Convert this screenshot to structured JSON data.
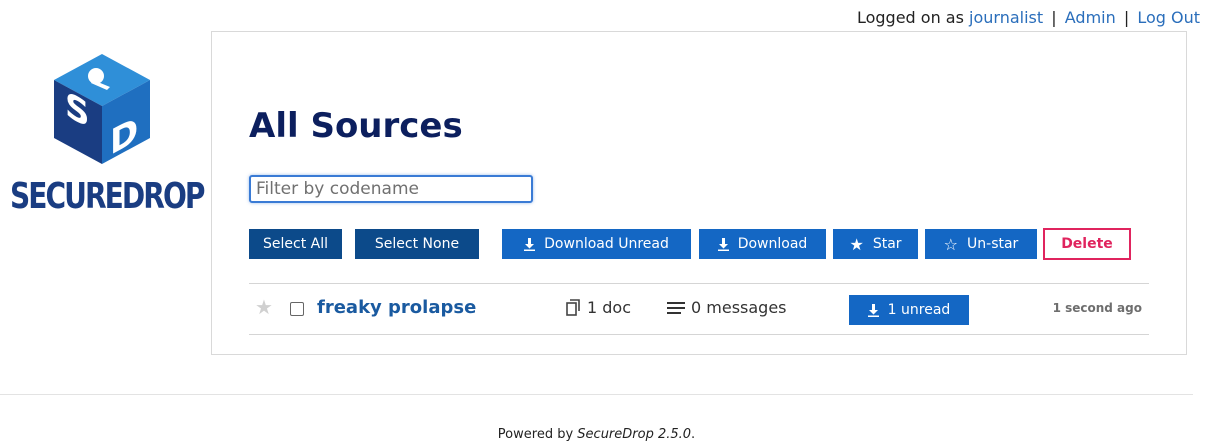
{
  "header": {
    "logged_on_prefix": "Logged on as",
    "username": "journalist",
    "separator": "|",
    "admin_link": "Admin",
    "logout_link": "Log Out"
  },
  "logo": {
    "word_secure": "SECURE",
    "word_drop": "DROP",
    "cube_letters": [
      "S",
      "D"
    ],
    "icon": "keyhole-cube-logo"
  },
  "main": {
    "title": "All Sources",
    "filter_placeholder": "Filter by codename",
    "toolbar": {
      "select_all": "Select All",
      "select_none": "Select None",
      "download_unread": "Download Unread",
      "download": "Download",
      "star": "Star",
      "unstar": "Un-star",
      "delete": "Delete"
    },
    "sources": [
      {
        "starred": false,
        "codename": "freaky prolapse",
        "docs": "1 doc",
        "messages": "0 messages",
        "unread_label": "1 unread",
        "last_updated": "1 second ago"
      }
    ]
  },
  "footer": {
    "prefix": "Powered by",
    "product": "SecureDrop 2.5.0",
    "suffix": "."
  },
  "colors": {
    "title": "#0c1f5e",
    "primary_button": "#1467c4",
    "dark_button": "#0c4a8a",
    "delete": "#e0245e",
    "link": "#2a6ebb",
    "logo_blue": "#1a3d82"
  }
}
